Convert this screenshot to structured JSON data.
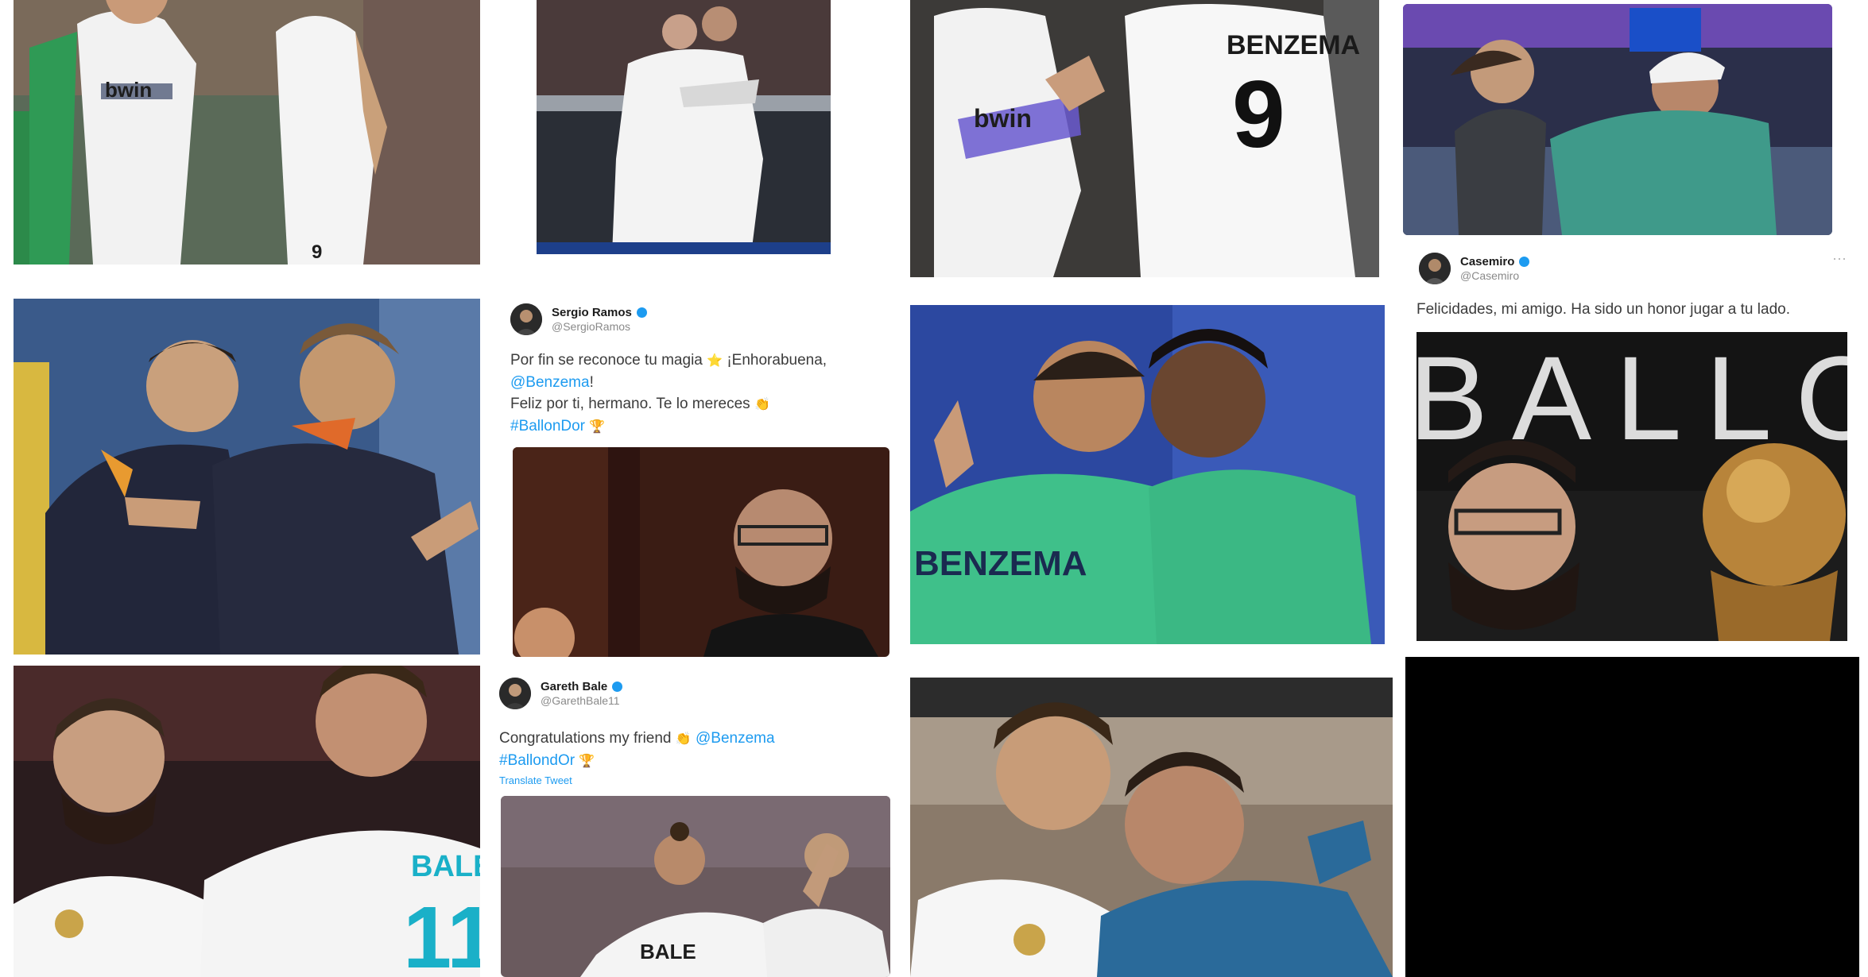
{
  "tweets": {
    "ramos": {
      "name": "Sergio Ramos",
      "handle": "@SergioRamos",
      "line1": "Por fin se reconoce tu magia",
      "line1_emoji": "⭐",
      "line1_end": "¡Enhorabuena,",
      "mention": "@Benzema",
      "punct": "!",
      "line3": "Feliz por ti, hermano. Te lo mereces",
      "line3_emoji": "👏",
      "hashtag": "#BallonDor",
      "hashtag_emoji": "🏆"
    },
    "bale": {
      "name": "Gareth Bale",
      "handle": "@GarethBale11",
      "line1": "Congratulations my friend",
      "line1_emoji": "👏",
      "mention": "@Benzema",
      "hashtag": "#BallondOr",
      "hashtag_emoji": "🏆",
      "source": "Translate Tweet"
    },
    "casemiro": {
      "name": "Casemiro",
      "handle": "@Casemiro",
      "text": "Felicidades, mi amigo. Ha sido un honor jugar a tu lado.",
      "more": "···"
    }
  },
  "photos": {
    "jersey_name": "BENZEMA",
    "jersey_number": "9",
    "green_jersey": "BENZEMA",
    "bale_name": "BALE",
    "bale_number": "11",
    "ballon_text": "BALLO",
    "sponsor": "bwin",
    "bale_back": "BALE"
  },
  "colors": {
    "accent": "#1d9bf0",
    "text": "#3c3c3c",
    "black_tile": "#000000"
  }
}
